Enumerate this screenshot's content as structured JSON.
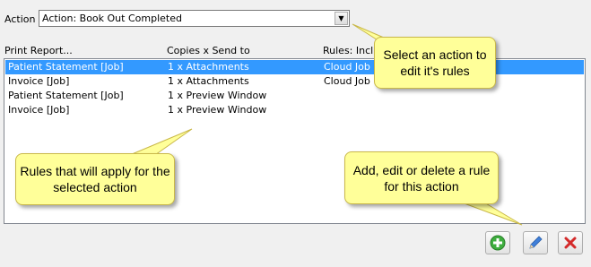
{
  "action": {
    "label": "Action",
    "selected": "Action: Book Out Completed"
  },
  "columns": {
    "report": "Print Report...",
    "copies": "Copies x Send to",
    "rules": "Rules: Incl"
  },
  "rows": [
    {
      "report": "Patient Statement  [Job]",
      "copies": "1 x Attachments",
      "rules": "Cloud Job",
      "selected": true
    },
    {
      "report": "Invoice  [Job]",
      "copies": "1 x Attachments",
      "rules": "Cloud Job",
      "selected": false
    },
    {
      "report": "Patient Statement  [Job]",
      "copies": "1 x Preview Window",
      "rules": "",
      "selected": false
    },
    {
      "report": "Invoice  [Job]",
      "copies": "1 x Preview Window",
      "rules": "",
      "selected": false
    }
  ],
  "callouts": {
    "select_action": "Select an action to edit it's rules",
    "rules_apply": "Rules that will apply for the selected action",
    "add_edit_delete": "Add, edit or delete a rule for this action"
  },
  "buttons": {
    "add_icon": "plus-circle-icon",
    "edit_icon": "pencil-icon",
    "delete_icon": "red-x-icon"
  },
  "colors": {
    "selection": "#3399ff",
    "callout_bg": "#ffff99",
    "add_green": "#3fae3f",
    "delete_red": "#d42a2a",
    "edit_blue": "#3f7fd9"
  }
}
